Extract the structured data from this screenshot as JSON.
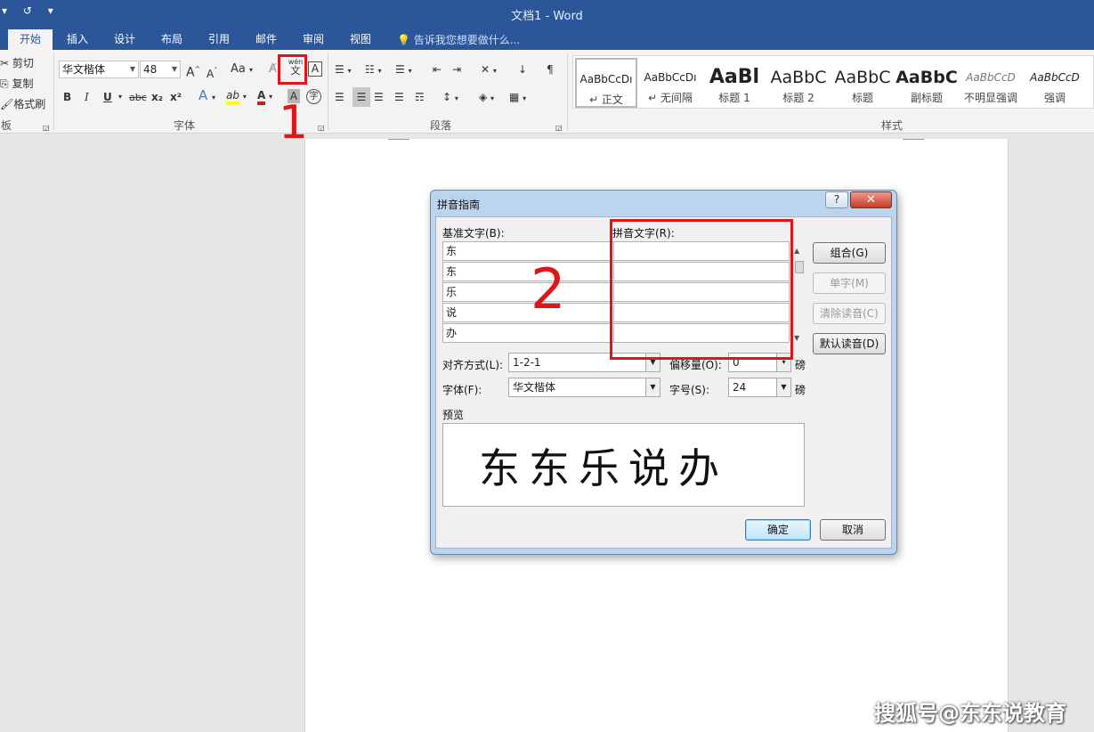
{
  "window": {
    "title": "文档1 - Word",
    "qat": {
      "dropdown": "▾",
      "redo": "↺",
      "customize": "▾"
    }
  },
  "tabs": [
    {
      "label": "开始",
      "active": true
    },
    {
      "label": "插入"
    },
    {
      "label": "设计"
    },
    {
      "label": "布局"
    },
    {
      "label": "引用"
    },
    {
      "label": "邮件"
    },
    {
      "label": "审阅"
    },
    {
      "label": "视图"
    }
  ],
  "tell_me": "告诉我您想要做什么...",
  "clipboard": {
    "cut": "剪切",
    "copy": "复制",
    "format_painter": "格式刷",
    "group_label": "板"
  },
  "font_group": {
    "font_name": "华文楷体",
    "font_size": "48",
    "grow": "A",
    "shrink": "A",
    "change_case": "Aa",
    "phonetic_guide_top": "wén",
    "phonetic_guide_bottom": "文",
    "char_border": "A",
    "bold": "B",
    "italic": "I",
    "underline": "U",
    "strike": "abc",
    "subscript": "x₂",
    "superscript": "x²",
    "text_effects": "A",
    "highlight": "ab",
    "font_color": "A",
    "char_shading": "A",
    "enclose": "字",
    "group_label": "字体"
  },
  "paragraph_group": {
    "group_label": "段落"
  },
  "styles_group": {
    "group_label": "样式",
    "items": [
      {
        "sample": "AaBbCcDı",
        "name": "↵ 正文"
      },
      {
        "sample": "AaBbCcDı",
        "name": "↵ 无间隔"
      },
      {
        "sample": "AaBl",
        "name": "标题 1"
      },
      {
        "sample": "AaBbC",
        "name": "标题 2"
      },
      {
        "sample": "AaBbC",
        "name": "标题"
      },
      {
        "sample": "AaBbC",
        "name": "副标题"
      },
      {
        "sample": "AaBbCcD",
        "name": "不明显强调"
      },
      {
        "sample": "AaBbCcD",
        "name": "强调"
      }
    ]
  },
  "annotations": {
    "one": "1",
    "two": "2"
  },
  "dialog": {
    "title": "拼音指南",
    "help": "?",
    "close": "✕",
    "base_text_label": "基准文字(B):",
    "ruby_text_label": "拼音文字(R):",
    "base_chars": [
      "东",
      "东",
      "乐",
      "说",
      "办"
    ],
    "ruby_chars": [
      "",
      "",
      "",
      "",
      ""
    ],
    "buttons": {
      "group": "组合(G)",
      "mono": "单字(M)",
      "clear": "清除读音(C)",
      "default_reading": "默认读音(D)",
      "ok": "确定",
      "cancel": "取消"
    },
    "alignment_label": "对齐方式(L):",
    "alignment_value": "1-2-1",
    "offset_label": "偏移量(O):",
    "offset_value": "0",
    "offset_unit": "磅",
    "font_label": "字体(F):",
    "font_value": "华文楷体",
    "size_label": "字号(S):",
    "size_value": "24",
    "size_unit": "磅",
    "preview_label": "预览",
    "preview_text": "东东乐说办"
  },
  "watermark": "搜狐号@东东说教育"
}
